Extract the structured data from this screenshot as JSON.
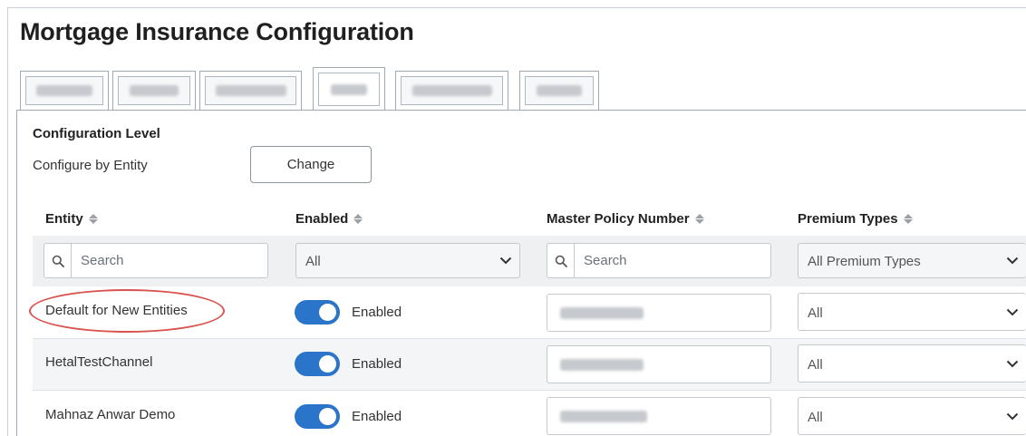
{
  "page": {
    "title": "Mortgage Insurance Configuration"
  },
  "tabs": [
    {
      "label": "",
      "active": false
    },
    {
      "label": "",
      "active": false
    },
    {
      "label": "",
      "active": false
    },
    {
      "label": "",
      "active": true
    },
    {
      "label": "",
      "active": false
    },
    {
      "label": "",
      "active": false
    }
  ],
  "config": {
    "heading": "Configuration Level",
    "label": "Configure by Entity",
    "change_label": "Change"
  },
  "table": {
    "columns": [
      {
        "label": "Entity",
        "icon": "sort-icon"
      },
      {
        "label": "Enabled",
        "icon": "sort-icon"
      },
      {
        "label": "Master Policy Number",
        "icon": "sort-icon"
      },
      {
        "label": "Premium Types",
        "icon": "sort-icon"
      }
    ],
    "filters": {
      "entity_placeholder": "Search",
      "enabled_value": "All",
      "policy_placeholder": "Search",
      "premium_value": "All Premium Types"
    },
    "rows": [
      {
        "entity": "Default for New Entities",
        "enabled": true,
        "enabled_label": "Enabled",
        "policy": "",
        "premium": "All",
        "highlighted": true
      },
      {
        "entity": "HetalTestChannel",
        "enabled": true,
        "enabled_label": "Enabled",
        "policy": "",
        "premium": "All",
        "highlighted": false
      },
      {
        "entity": "Mahnaz Anwar Demo",
        "enabled": true,
        "enabled_label": "Enabled",
        "policy": "",
        "premium": "All",
        "highlighted": false
      }
    ]
  },
  "colors": {
    "accent": "#2a74c9",
    "highlight": "#d9534f"
  }
}
